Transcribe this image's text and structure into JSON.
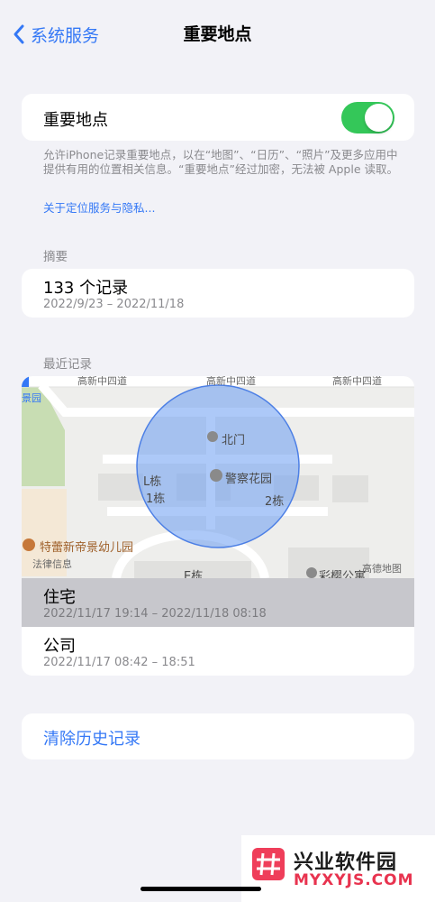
{
  "nav": {
    "back_label": "系统服务",
    "title": "重要地点"
  },
  "toggle": {
    "label": "重要地点",
    "on": true,
    "color": "#34c759"
  },
  "footer": {
    "description": "允许iPhone记录重要地点，以在“地图”、“日历”、“照片”及更多应用中提供有用的位置相关信息。“重要地点”经过加密，无法被 Apple 读取。",
    "link": "关于定位服务与隐私..."
  },
  "summary": {
    "header": "摘要",
    "title": "133 个记录",
    "range": "2022/9/23 – 2022/11/18"
  },
  "recent": {
    "header": "最近记录",
    "map_labels": {
      "road_left": "高新中四道",
      "road_mid": "高新中四道",
      "road_right": "高新中四道",
      "park": "景园",
      "gate": "北门",
      "community": "警察花园",
      "building_l": "L栋",
      "building_1": "1栋",
      "building_2": "2栋",
      "building_e": "E栋",
      "kindergarten": "特蕾新帝景幼儿园",
      "legal": "法律信息",
      "apartment": "彩樱公寓",
      "provider": "高德地图"
    },
    "items": [
      {
        "title": "住宅",
        "time": "2022/11/17 19:14 – 2022/11/18 08:18",
        "selected": true
      },
      {
        "title": "公司",
        "time": "2022/11/17 08:42 – 18:51",
        "selected": false
      }
    ]
  },
  "clear": {
    "label": "清除历史记录"
  },
  "watermark": {
    "name": "兴业软件园",
    "url": "MYXYJS.COM"
  },
  "colors": {
    "accent": "#3478f6",
    "background": "#f2f2f7",
    "selected_row": "#c7c7cc"
  }
}
